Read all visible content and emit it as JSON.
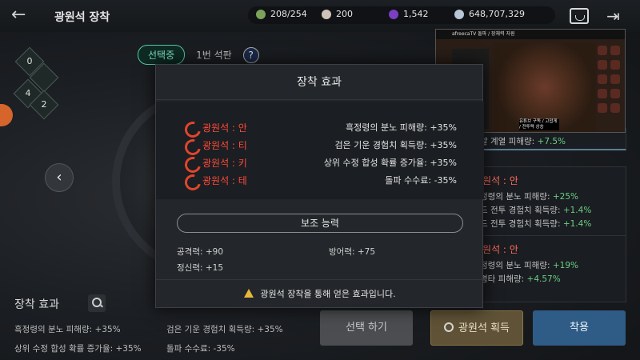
{
  "header": {
    "title": "광원석 장착",
    "back_icon": "back-arrow-icon",
    "resources": [
      {
        "icon": "green-gem-icon",
        "color": "#7da35a",
        "value": "208/254"
      },
      {
        "icon": "pearl-icon",
        "color": "#cfc3b8",
        "value": "200"
      },
      {
        "icon": "purple-orb-icon",
        "color": "#7a3fc2",
        "value": "1,542"
      },
      {
        "icon": "silver-coin-icon",
        "color": "#b8c6d6",
        "value": "648,707,329"
      }
    ]
  },
  "tabs": {
    "active": "선택중",
    "second": "1번 석판",
    "help": "?"
  },
  "runes_left": [
    "0",
    "4",
    "2"
  ],
  "modal": {
    "title": "장착 효과",
    "runes": [
      {
        "name": "광원석 : 안",
        "effect": "흑정령의 분노 피해량: +35%"
      },
      {
        "name": "광원석 : 티",
        "effect": "검은 기운 경험치 획득량: +35%"
      },
      {
        "name": "광원석 : 키",
        "effect": "상위 수정 합성 확률 증가율: +35%"
      },
      {
        "name": "광원석 : 테",
        "effect": "돌파 수수료: -35%"
      }
    ],
    "assist_title": "보조 능력",
    "stats": {
      "atk": "공격력: +90",
      "def": "방어력: +75",
      "spirit": "정신력: +15"
    },
    "notice": "광원석 장착을 통해 얻은 효과입니다."
  },
  "right_cards": {
    "top_line_prefix": "알 계열 피해량: ",
    "top_line_value": "+7.5%",
    "mid": {
      "title": "광원석 : 안",
      "lines": [
        {
          "text": "정령의 분노 피해량: ",
          "value": "+25%"
        },
        {
          "text": "드 전투 경험치 획득량: ",
          "value": "+1.4%"
        },
        {
          "text": "드 전투 경험치 획득량: ",
          "value": "+1.4%"
        }
      ]
    },
    "bot": {
      "title": "광원석 : 안",
      "lines": [
        {
          "text": "정령의 분노 피해량: ",
          "value": "+19%"
        },
        {
          "text": "명타 피해량: ",
          "value": "+4.57%"
        }
      ]
    }
  },
  "bottom": {
    "label": "장착 효과",
    "effects": [
      "흑정령의 분노 피해량: +35%",
      "검은 기운 경험치 획득량: +35%",
      "상위 수정 합성 확률 증가율: +35%",
      "돌파 수수료: -35%"
    ],
    "buttons": {
      "select": "선택 하기",
      "acquire": "광원석 획득",
      "equip": "착용"
    }
  },
  "pip": {
    "header_text": "afreecaTV 돌파 / 장체력 자원",
    "badge_text": "유튜브 구독 / 고맙게 / 전투력 상승"
  }
}
